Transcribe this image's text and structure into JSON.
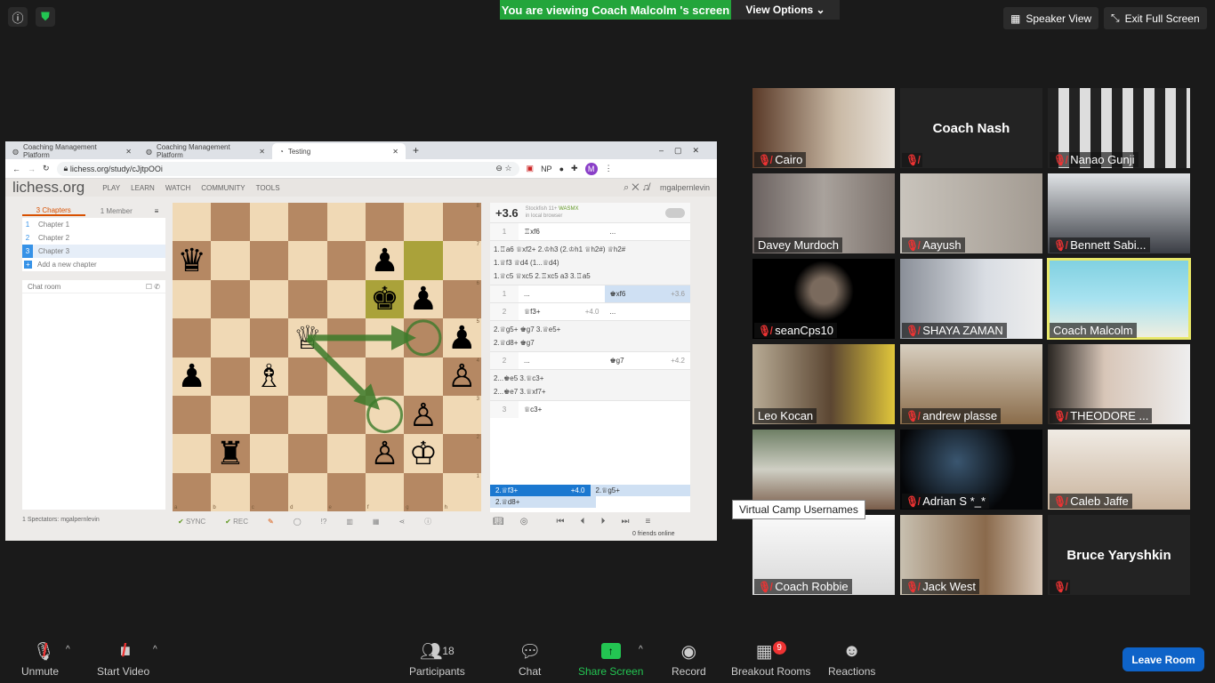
{
  "top": {
    "banner": "You are viewing Coach Malcolm 's screen",
    "view_options": "View Options ⌄",
    "speaker_view": "Speaker View",
    "exit_fullscreen": "Exit Full Screen"
  },
  "browser": {
    "tabs": [
      {
        "label": "Coaching Management Platform"
      },
      {
        "label": "Coaching Management Platform"
      },
      {
        "label": "Testing"
      }
    ],
    "url": "lichess.org/study/cJjtpOOi",
    "profile_initial": "M",
    "ext_np": "NP"
  },
  "lichess": {
    "logo": "lichess.org",
    "nav": [
      "PLAY",
      "LEARN",
      "WATCH",
      "COMMUNITY",
      "TOOLS"
    ],
    "user": "mgalpernlevin",
    "chapters_tab": "3 Chapters",
    "members_tab": "1 Member",
    "chapters": [
      {
        "n": "1",
        "label": "Chapter 1"
      },
      {
        "n": "2",
        "label": "Chapter 2"
      },
      {
        "n": "3",
        "label": "Chapter 3"
      }
    ],
    "add_chapter": "Add a new chapter",
    "chat_room": "Chat room",
    "spectators": "1 Spectators: mgalpernlevin",
    "sync": "SYNC",
    "rec": "REC",
    "friends": "0 friends online",
    "eval": "+3.6",
    "engine": "Stockfish 11+",
    "engine_tag": "WASMX",
    "engine_sub": "in local browser",
    "board": [
      "........",
      "q....p.h",
      ".....kp.",
      "...Q...p",
      "p.B....P",
      "......P.",
      ".r...PK.",
      "........"
    ],
    "highlight": [
      "g7",
      "f6"
    ],
    "arrow_color": "#3c7a2a",
    "moves": [
      {
        "type": "row",
        "n": "1",
        "w": "♖xf6",
        "b": "..."
      },
      {
        "type": "var",
        "lines": [
          "1.♖a6 ♕xf2+ 2.♔h3 (2.♔h1 ♕h2#) ♕h2#",
          "1.♕f3 ♕d4 (1...♕d4)",
          "1.♕c5 ♕xc5 2.♖xc5 a3 3.♖a5"
        ]
      },
      {
        "type": "row",
        "n": "1",
        "w": "...",
        "b": "♚xf6",
        "be": "+3.6",
        "sel": "b"
      },
      {
        "type": "row",
        "n": "2",
        "w": "♕f3+",
        "we": "+4.0",
        "b": "..."
      },
      {
        "type": "var",
        "lines": [
          "2.♕g5+ ♚g7 3.♕e5+",
          "2.♕d8+ ♚g7"
        ]
      },
      {
        "type": "row",
        "n": "2",
        "w": "...",
        "b": "♚g7",
        "be": "+4.2"
      },
      {
        "type": "var",
        "lines": [
          "2...♚e5 3.♕c3+",
          "2...♚e7 3.♕xf7+"
        ]
      },
      {
        "type": "row",
        "n": "3",
        "w": "♕c3+",
        "b": ""
      }
    ],
    "candidates": [
      {
        "label": "2.♕f3+",
        "eval": "+4.0"
      },
      {
        "label": "2.♕g5+",
        "eval": ""
      },
      {
        "label": "2.♕d8+",
        "eval": ""
      }
    ]
  },
  "participants": [
    {
      "name": "Cairo",
      "muted": true,
      "bg": "linear-gradient(90deg,#5a3a28,#c9b9a5 60%,#e8e2da)"
    },
    {
      "name": "Coach Nash",
      "muted": true,
      "center": true
    },
    {
      "name": "Nanao Gunji",
      "muted": true,
      "bg": "repeating-linear-gradient(90deg,#222 0 12px,#ddd 12px 24px)"
    },
    {
      "name": "Davey Murdoch",
      "muted": false,
      "bg": "linear-gradient(90deg,#6b6260,#a9a29c 50%,#7b716b)"
    },
    {
      "name": "Aayush",
      "muted": true,
      "bg": "linear-gradient(90deg,#c9c4bc,#a39b92)"
    },
    {
      "name": "Bennett Sabi...",
      "muted": true,
      "bg": "linear-gradient(180deg,#e0e3e6,#3a3d44)"
    },
    {
      "name": "seanCps10",
      "muted": true,
      "bg": "radial-gradient(circle at 50% 40%,#7a6a5d 15%,#000 35%)"
    },
    {
      "name": "SHAYA ZAMAN",
      "muted": true,
      "bg": "linear-gradient(90deg,#8a8f98,#d9dde3 60%,#eee)"
    },
    {
      "name": "Coach Malcolm",
      "muted": false,
      "active": true,
      "bg": "linear-gradient(180deg,#7fd0e0,#a7e2f0 50%,#f2efe0)"
    },
    {
      "name": "Leo Kocan",
      "muted": false,
      "bg": "linear-gradient(90deg,#b8ab95,#5b4632 55%,#e0c63b)"
    },
    {
      "name": "andrew plasse",
      "muted": true,
      "bg": "linear-gradient(180deg,#d8cfc0,#8a6c4a)"
    },
    {
      "name": "THEODORE ...",
      "muted": true,
      "bg": "linear-gradient(90deg,#2a2622,#d8c6b8 40%,#eee)"
    },
    {
      "name": "",
      "muted": false,
      "bg": "linear-gradient(180deg,#6e7f65,#cfcfc4 50%,#7a5d4a)"
    },
    {
      "name": "Adrian S *_*",
      "muted": true,
      "bg": "radial-gradient(circle at 40% 40%,#3a5670,#050608 60%)"
    },
    {
      "name": "Caleb Jaffe",
      "muted": true,
      "bg": "linear-gradient(180deg,#f0ebe4,#c9b39c)"
    },
    {
      "name": "Coach Robbie",
      "muted": true,
      "bg": "linear-gradient(180deg,#fafafa,#d8d8d8)"
    },
    {
      "name": "Jack West",
      "muted": true,
      "bg": "linear-gradient(90deg,#c8c0b0,#8a6a4c 60%,#d8c8b8)"
    },
    {
      "name": "Bruce Yaryshkin",
      "muted": true,
      "center": true
    }
  ],
  "tooltip": "Virtual Camp Usernames",
  "toolbar": {
    "unmute": "Unmute",
    "start_video": "Start Video",
    "participants": "Participants",
    "participant_count": "18",
    "chat": "Chat",
    "share_screen": "Share Screen",
    "record": "Record",
    "breakout": "Breakout Rooms",
    "breakout_count": "9",
    "reactions": "Reactions",
    "leave": "Leave Room"
  },
  "colors": {
    "share_green": "#23a53b",
    "leave_blue": "#0e63c8",
    "active_speaker": "#e8e86a"
  }
}
